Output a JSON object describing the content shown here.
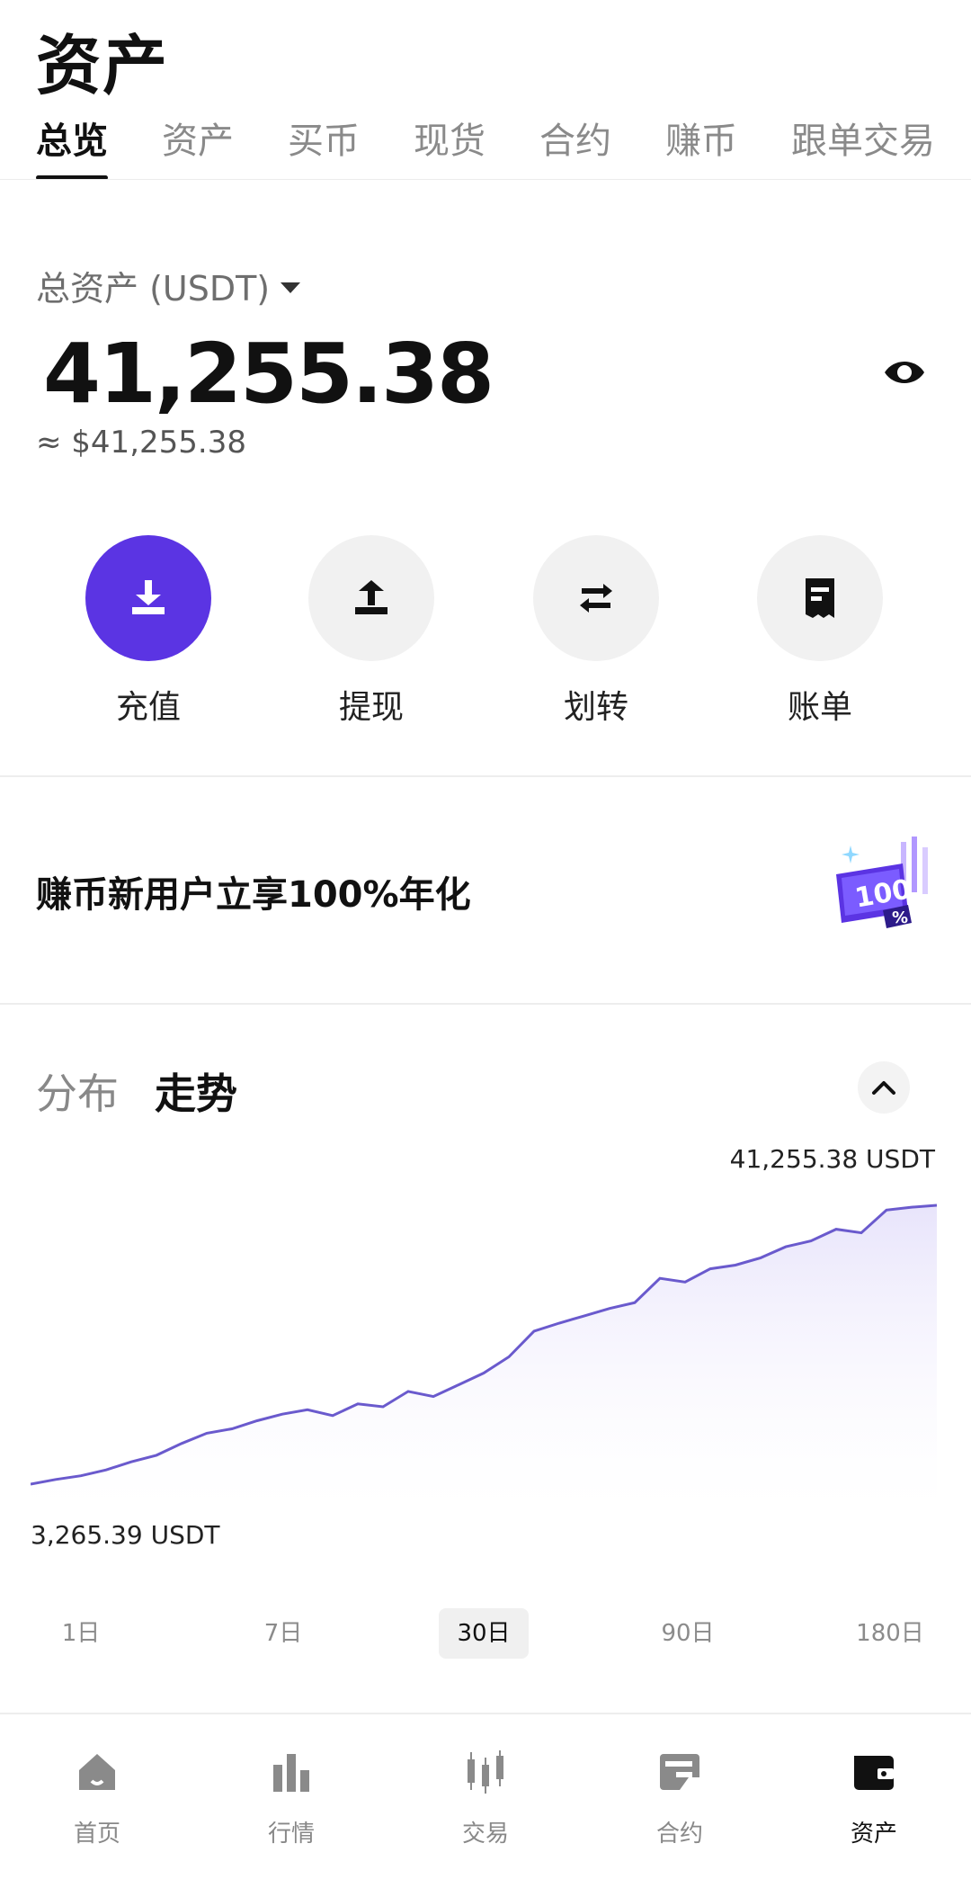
{
  "page": {
    "title": "资产"
  },
  "tabs": [
    {
      "label": "总览",
      "active": true
    },
    {
      "label": "资产",
      "active": false
    },
    {
      "label": "买币",
      "active": false
    },
    {
      "label": "现货",
      "active": false
    },
    {
      "label": "合约",
      "active": false
    },
    {
      "label": "赚币",
      "active": false
    },
    {
      "label": "跟单交易",
      "active": false
    }
  ],
  "summary": {
    "label": "总资产 (USDT)",
    "value": "41,255.38",
    "approx": "≈ $41,255.38"
  },
  "actions": [
    {
      "label": "充值",
      "icon": "deposit-icon",
      "primary": true
    },
    {
      "label": "提现",
      "icon": "withdraw-icon",
      "primary": false
    },
    {
      "label": "划转",
      "icon": "transfer-icon",
      "primary": false
    },
    {
      "label": "账单",
      "icon": "bill-icon",
      "primary": false
    }
  ],
  "promo": {
    "text": "赚币新用户立享100%年化",
    "badge_icon": "100-percent-badge-icon"
  },
  "chart_section": {
    "segments": [
      {
        "label": "分布",
        "active": false
      },
      {
        "label": "走势",
        "active": true
      }
    ],
    "max_label": "41,255.38 USDT",
    "min_label": "3,265.39 USDT",
    "ranges": [
      {
        "label": "1日",
        "active": false
      },
      {
        "label": "7日",
        "active": false
      },
      {
        "label": "30日",
        "active": true
      },
      {
        "label": "90日",
        "active": false
      },
      {
        "label": "180日",
        "active": false
      }
    ]
  },
  "chart_data": {
    "type": "area",
    "ylim": [
      3265.39,
      41255.38
    ],
    "values": [
      3265.39,
      3900,
      4400,
      5200,
      6300,
      7200,
      8800,
      10200,
      10800,
      11900,
      12800,
      13400,
      12600,
      14200,
      13800,
      15900,
      15200,
      16800,
      18400,
      20600,
      24100,
      25200,
      26200,
      27200,
      28000,
      31300,
      30800,
      32600,
      33100,
      34100,
      35600,
      36400,
      38000,
      37500,
      40600,
      41000,
      41255.38
    ]
  },
  "nav": [
    {
      "label": "首页",
      "icon": "home-icon",
      "active": false
    },
    {
      "label": "行情",
      "icon": "market-chart-icon",
      "active": false
    },
    {
      "label": "交易",
      "icon": "trade-candles-icon",
      "active": false
    },
    {
      "label": "合约",
      "icon": "futures-icon",
      "active": false
    },
    {
      "label": "资产",
      "icon": "wallet-icon",
      "active": true
    }
  ],
  "colors": {
    "accent": "#5b34e3",
    "line": "#6a5acd",
    "area_top": "#e8e4fb"
  }
}
